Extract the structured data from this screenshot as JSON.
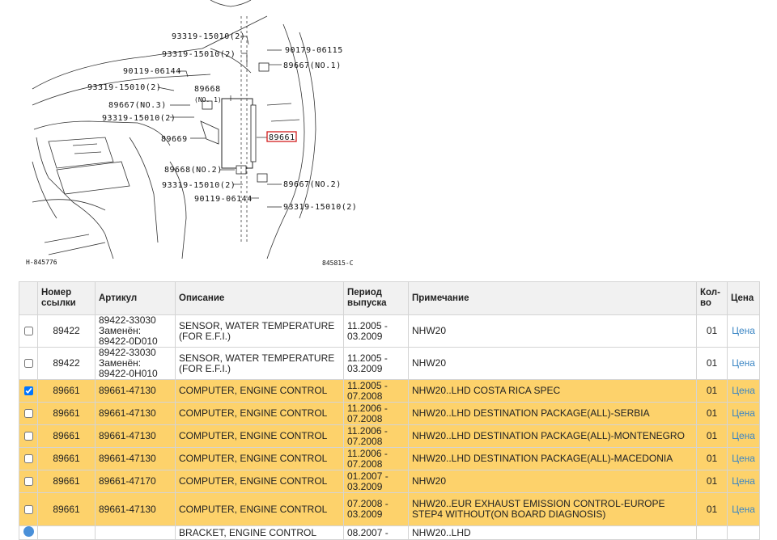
{
  "diagram": {
    "labels": {
      "l1": "93319-15010(2)",
      "l2": "93319-15010(2)",
      "l3": "90179-06115",
      "l4": "89667(NO.1)",
      "l5": "90119-06144",
      "l6": "93319-15010(2)",
      "l7": "89668",
      "l7b": "(NO. 1)",
      "l8": "89667(NO.3)",
      "l9": "93319-15010(2)",
      "l10": "89669",
      "l11": "89661",
      "l12": "89668(NO.2)",
      "l13": "93319-15010(2)",
      "l14": "89667(NO.2)",
      "l15": "90119-06144",
      "l16": "93319-15010(2)",
      "ref_left": "H-845776",
      "ref_right": "845815-C"
    }
  },
  "table": {
    "headers": {
      "ref": "Номер ссылки",
      "article": "Артикул",
      "desc": "Описание",
      "period": "Период выпуска",
      "note": "Примечание",
      "qty": "Кол-во",
      "price": "Цена"
    },
    "rows": [
      {
        "checked": false,
        "ref": "89422",
        "article": "89422-33030 Заменён: 89422-0D010",
        "desc": "SENSOR, WATER TEMPERATURE (FOR E.F.I.)",
        "period": "11.2005 - 03.2009",
        "note": "NHW20",
        "qty": "01",
        "price": "Цена"
      },
      {
        "checked": false,
        "ref": "89422",
        "article": "89422-33030 Заменён: 89422-0H010",
        "desc": "SENSOR, WATER TEMPERATURE (FOR E.F.I.)",
        "period": "11.2005 - 03.2009",
        "note": "NHW20",
        "qty": "01",
        "price": "Цена"
      },
      {
        "checked": true,
        "ref": "89661",
        "article": "89661-47130",
        "desc": "COMPUTER, ENGINE CONTROL",
        "period": "11.2005 - 07.2008",
        "note": "NHW20..LHD COSTA RICA SPEC",
        "qty": "01",
        "price": "Цена"
      },
      {
        "checked": false,
        "ref": "89661",
        "article": "89661-47130",
        "desc": "COMPUTER, ENGINE CONTROL",
        "period": "11.2006 - 07.2008",
        "note": "NHW20..LHD DESTINATION PACKAGE(ALL)-SERBIA",
        "qty": "01",
        "price": "Цена"
      },
      {
        "checked": false,
        "ref": "89661",
        "article": "89661-47130",
        "desc": "COMPUTER, ENGINE CONTROL",
        "period": "11.2006 - 07.2008",
        "note": "NHW20..LHD DESTINATION PACKAGE(ALL)-MONTENEGRO",
        "qty": "01",
        "price": "Цена"
      },
      {
        "checked": false,
        "ref": "89661",
        "article": "89661-47130",
        "desc": "COMPUTER, ENGINE CONTROL",
        "period": "11.2006 - 07.2008",
        "note": "NHW20..LHD DESTINATION PACKAGE(ALL)-MACEDONIA",
        "qty": "01",
        "price": "Цена"
      },
      {
        "checked": false,
        "ref": "89661",
        "article": "89661-47170",
        "desc": "COMPUTER, ENGINE CONTROL",
        "period": "01.2007 - 03.2009",
        "note": "NHW20",
        "qty": "01",
        "price": "Цена"
      },
      {
        "checked": false,
        "ref": "89661",
        "article": "89661-47130",
        "desc": "COMPUTER, ENGINE CONTROL",
        "period": "07.2008 - 03.2009",
        "note": "NHW20..EUR EXHAUST EMISSION CONTROL-EUROPE STEP4 WITHOUT(ON BOARD DIAGNOSIS)",
        "qty": "01",
        "price": "Цена"
      },
      {
        "checked": false,
        "ref": "",
        "article": "",
        "desc": "BRACKET, ENGINE CONTROL",
        "period": "08.2007 -",
        "note": "NHW20..LHD",
        "qty": "",
        "price": ""
      }
    ]
  }
}
